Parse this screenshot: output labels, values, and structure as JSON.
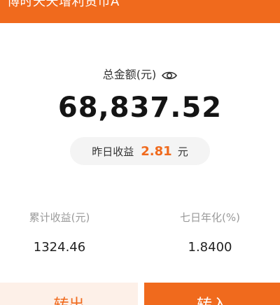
{
  "header": {
    "title": "博时天天增利货币A",
    "background_color": "#f06a1d"
  },
  "summary": {
    "total_label": "总金额(元)",
    "visibility_icon": "eye-icon",
    "total_amount": "68,837.52",
    "yesterday_label": "昨日收益",
    "yesterday_value": "2.81",
    "yesterday_unit": "元"
  },
  "stats": {
    "cumulative_label": "累计收益(元)",
    "cumulative_value": "1324.46",
    "seven_day_label": "七日年化(%)",
    "seven_day_value": "1.8400"
  },
  "actions": {
    "transfer_out_label": "转出",
    "transfer_in_label": "转入"
  },
  "colors": {
    "accent": "#f06a1d",
    "accent_light": "#fdf0e8",
    "pill_bg": "#f4f4f4"
  }
}
